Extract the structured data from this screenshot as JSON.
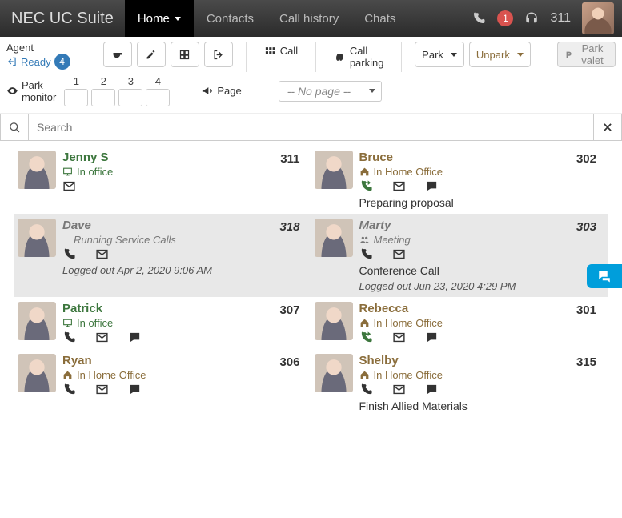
{
  "brand": "NEC UC Suite",
  "nav": {
    "home": "Home",
    "contacts": "Contacts",
    "call_history": "Call history",
    "chats": "Chats",
    "alerts": "1",
    "ext": "311"
  },
  "agent": {
    "label": "Agent",
    "ready": "Ready",
    "count": "4"
  },
  "toolbar": {
    "call": "Call",
    "call_parking": "Call parking",
    "park": "Park",
    "unpark": "Unpark",
    "park_valet": "Park valet",
    "park_monitor": "Park monitor",
    "page": "Page",
    "no_page": "-- No page --",
    "slots": [
      "1",
      "2",
      "3",
      "4"
    ]
  },
  "search": {
    "placeholder": "Search"
  },
  "presence": {
    "in_office": "In office",
    "in_home_office": "In Home Office",
    "meeting": "Meeting"
  },
  "contacts": [
    {
      "name": "Jenny S",
      "ext": "311",
      "presence": "in_office",
      "presence_color": "green",
      "name_color": "green",
      "icons": [
        "monitor",
        "envelope"
      ],
      "phoneStyle": "none",
      "note": "",
      "logged": ""
    },
    {
      "name": "Bruce",
      "ext": "302",
      "presence": "in_home_office",
      "presence_color": "brown",
      "name_color": "brown",
      "icons": [
        "house",
        "phone-green",
        "envelope",
        "chat"
      ],
      "note": "Preparing proposal",
      "logged": ""
    },
    {
      "name": "Dave",
      "ext": "318",
      "presence": "",
      "presence_color": "grey",
      "name_color": "grey",
      "sub": "Running Service Calls",
      "icons": [
        "phone",
        "envelope"
      ],
      "note": "",
      "logged": "Logged out Apr 2, 2020 9:06 AM",
      "dim": true
    },
    {
      "name": "Marty",
      "ext": "303",
      "presence": "meeting",
      "presence_color": "grey",
      "name_color": "grey",
      "icons": [
        "people",
        "phone",
        "envelope"
      ],
      "note": "Conference Call",
      "logged": "Logged out Jun 23, 2020 4:29 PM",
      "dim": true
    },
    {
      "name": "Patrick",
      "ext": "307",
      "presence": "in_office",
      "presence_color": "green",
      "name_color": "green",
      "icons": [
        "monitor",
        "phone",
        "envelope",
        "chat"
      ],
      "note": "",
      "logged": ""
    },
    {
      "name": "Rebecca",
      "ext": "301",
      "presence": "in_home_office",
      "presence_color": "brown",
      "name_color": "brown",
      "icons": [
        "house",
        "phone-green",
        "envelope",
        "chat"
      ],
      "note": "",
      "logged": ""
    },
    {
      "name": "Ryan",
      "ext": "306",
      "presence": "in_home_office",
      "presence_color": "brown",
      "name_color": "brown",
      "icons": [
        "house",
        "phone",
        "envelope",
        "chat"
      ],
      "note": "",
      "logged": ""
    },
    {
      "name": "Shelby",
      "ext": "315",
      "presence": "in_home_office",
      "presence_color": "brown",
      "name_color": "brown",
      "icons": [
        "house",
        "phone",
        "envelope",
        "chat"
      ],
      "note": "Finish Allied Materials",
      "logged": ""
    }
  ]
}
